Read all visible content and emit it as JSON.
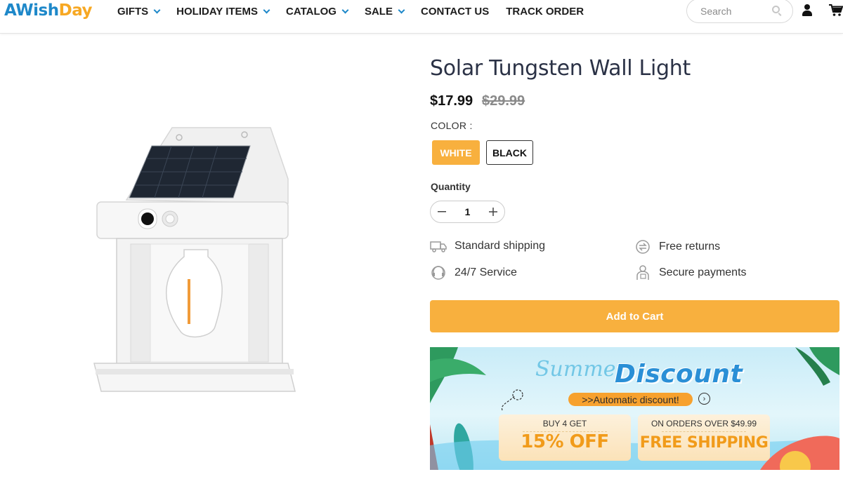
{
  "header": {
    "logo": {
      "part1": "A",
      "part2": "Wish",
      "part3": "Day"
    },
    "nav": [
      {
        "label": "GIFTS",
        "dropdown": true
      },
      {
        "label": "HOLIDAY ITEMS",
        "dropdown": true
      },
      {
        "label": "CATALOG",
        "dropdown": true
      },
      {
        "label": "SALE",
        "dropdown": true
      },
      {
        "label": "CONTACT US",
        "dropdown": false
      },
      {
        "label": "TRACK ORDER",
        "dropdown": false
      }
    ],
    "search": {
      "placeholder": "Search"
    },
    "icons": [
      "user-icon",
      "cart-icon"
    ]
  },
  "product": {
    "title": "Solar Tungsten Wall Light",
    "price": "$17.99",
    "compare_price": "$29.99",
    "color_label": "COLOR :",
    "colors": [
      {
        "label": "WHITE",
        "selected": true
      },
      {
        "label": "BLACK",
        "selected": false
      }
    ],
    "quantity_label": "Quantity",
    "quantity": "1",
    "features": [
      {
        "icon": "truck-icon",
        "label": "Standard shipping"
      },
      {
        "icon": "returns-icon",
        "label": "Free returns"
      },
      {
        "icon": "headset-icon",
        "label": "24/7 Service"
      },
      {
        "icon": "secure-payment-icon",
        "label": "Secure payments"
      }
    ],
    "add_to_cart": "Add to Cart"
  },
  "banner": {
    "script_text": "Summer",
    "headline": "Discount",
    "automatic": ">>Automatic discount!",
    "offer1_small": "BUY 4 GET",
    "offer1_big": "15% OFF",
    "offer2_small": "ON ORDERS OVER $49.99",
    "offer2_big": "FREE SHIPPING"
  },
  "colors": {
    "accent": "#f8b03e",
    "brand_blue": "#1e88c9",
    "title": "#2b3246"
  }
}
